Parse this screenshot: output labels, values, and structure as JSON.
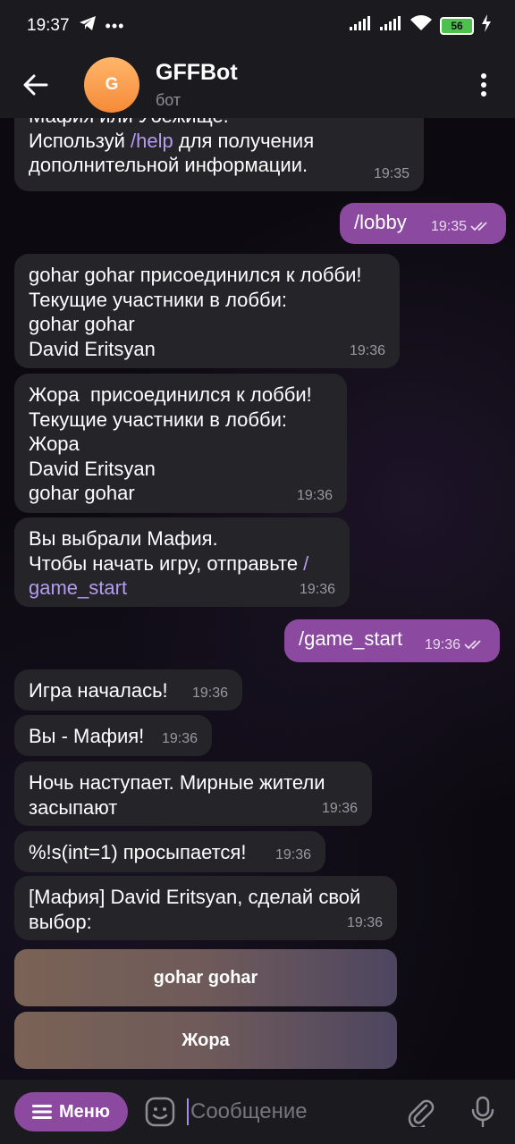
{
  "status": {
    "time": "19:37",
    "battery": "56"
  },
  "header": {
    "title": "GFFBot",
    "subtitle": "бот",
    "avatar_letter": "G"
  },
  "messages": [
    {
      "text_pre": "Мафия или Убежище.\nИспользуй ",
      "link": "/help",
      "text_post": " для получения\nдополнительной информации.",
      "time": "19:35"
    },
    {
      "text": "/lobby",
      "time": "19:35"
    },
    {
      "text": "gohar gohar присоединился к лобби!\nТекущие участники в лобби:\ngohar gohar\nDavid Eritsyan",
      "time": "19:36"
    },
    {
      "text": "Жора  присоединился к лобби!\nТекущие участники в лобби:\nЖора\nDavid Eritsyan\ngohar gohar",
      "time": "19:36"
    },
    {
      "text_pre": "Вы выбрали Мафия.\nЧтобы начать игру, отправьте ",
      "link": "/\ngame_start",
      "time": "19:36"
    },
    {
      "text": "/game_start",
      "time": "19:36"
    },
    {
      "text": "Игра началась!",
      "time": "19:36"
    },
    {
      "text": "Вы - Мафия!",
      "time": "19:36"
    },
    {
      "text": "Ночь наступает. Мирные жители\nзасыпают",
      "time": "19:36"
    },
    {
      "text": "%!s(int=1) просыпается!",
      "time": "19:36"
    },
    {
      "text": "[Мафия] David Eritsyan, сделай свой\nвыбор:",
      "time": "19:36"
    }
  ],
  "keyboard": [
    "gohar gohar",
    "Жора"
  ],
  "input": {
    "menu_label": "Меню",
    "placeholder": "Сообщение"
  },
  "colors": {
    "outgoing": "#8b4a9f",
    "incoming": "#252429",
    "accent": "#8b4a9f",
    "link": "#b49cf0"
  },
  "icons": [
    "telegram-icon",
    "more-icon",
    "signal-icon",
    "wifi-icon",
    "battery-icon",
    "charging-icon",
    "back-arrow-icon",
    "more-vert-icon",
    "double-check-icon",
    "menu-icon",
    "emoji-icon",
    "attach-icon",
    "mic-icon"
  ]
}
